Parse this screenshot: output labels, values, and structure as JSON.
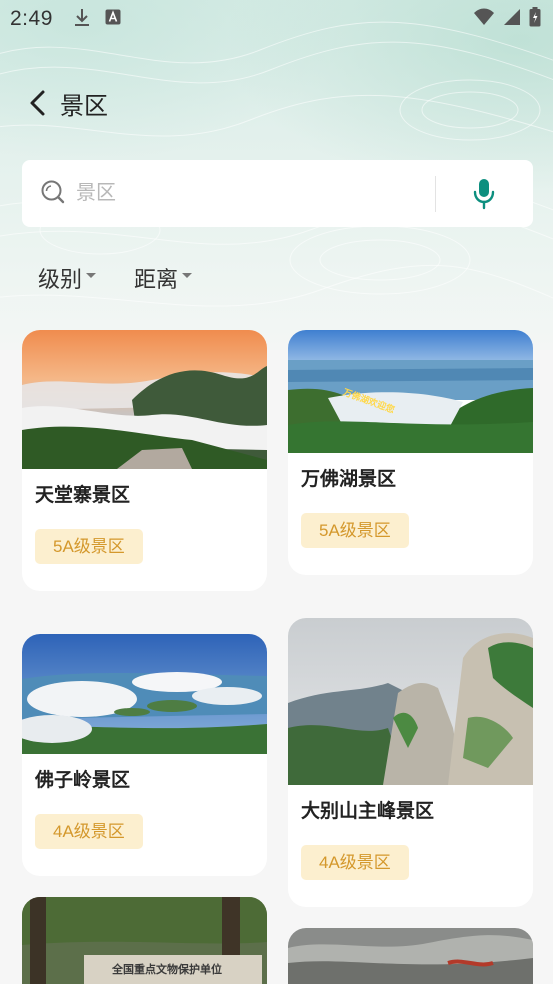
{
  "status": {
    "time": "2:49"
  },
  "header": {
    "title": "景区"
  },
  "search": {
    "placeholder": "景区",
    "value": ""
  },
  "filters": [
    {
      "label": "级别"
    },
    {
      "label": "距离"
    }
  ],
  "scenic_spots": [
    {
      "name": "天堂寨景区",
      "level": "5A级景区"
    },
    {
      "name": "万佛湖景区",
      "level": "5A级景区",
      "photo_text": "万佛湖欢迎您"
    },
    {
      "name": "佛子岭景区",
      "level": "4A级景区"
    },
    {
      "name": "大别山主峰景区",
      "level": "4A级景区"
    },
    {
      "name": "",
      "level": "",
      "photo_text": "全国重点文物保护单位"
    },
    {
      "name": "",
      "level": ""
    }
  ],
  "colors": {
    "accent": "#0d8f7f",
    "badge_bg": "#fcefcf",
    "badge_text": "#d4982c"
  }
}
